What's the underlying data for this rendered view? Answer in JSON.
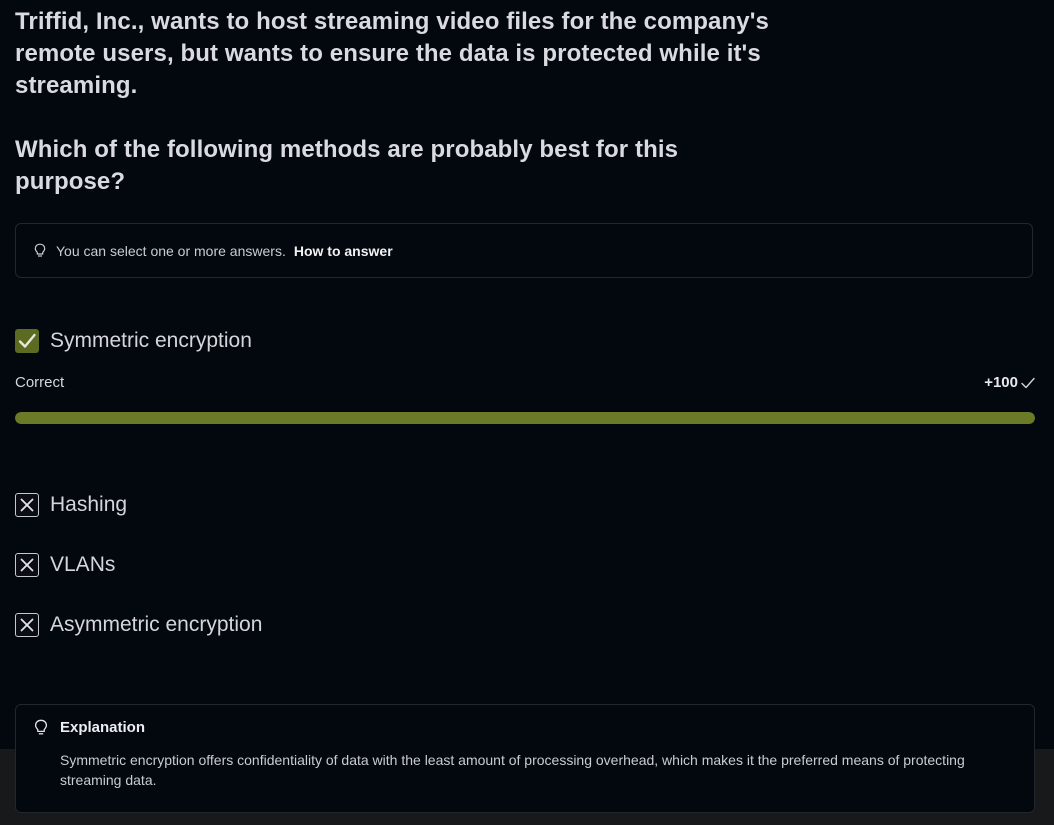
{
  "question": {
    "line1": "Triffid, Inc., wants to host streaming video files for the company's remote users, but wants to ensure the data is protected while it's streaming.",
    "line2": "Which of the following methods are probably best for this purpose?"
  },
  "hint": {
    "text": "You can select one or more answers.",
    "link": "How to answer",
    "icon": "lightbulb-icon"
  },
  "options": [
    {
      "label": "Symmetric encryption",
      "state": "checked"
    },
    {
      "label": "Hashing",
      "state": "incorrect"
    },
    {
      "label": "VLANs",
      "state": "incorrect"
    },
    {
      "label": "Asymmetric encryption",
      "state": "incorrect"
    }
  ],
  "result": {
    "status": "Correct",
    "score": "+100",
    "progress": 1.0
  },
  "explanation": {
    "title": "Explanation",
    "text": "Symmetric encryption offers confidentiality of data with the least amount of processing overhead, which makes it the preferred means of protecting streaming data."
  },
  "colors": {
    "background": "#03070e",
    "accent_green": "#6a7a26",
    "checkbox_green": "#5c6b22"
  }
}
